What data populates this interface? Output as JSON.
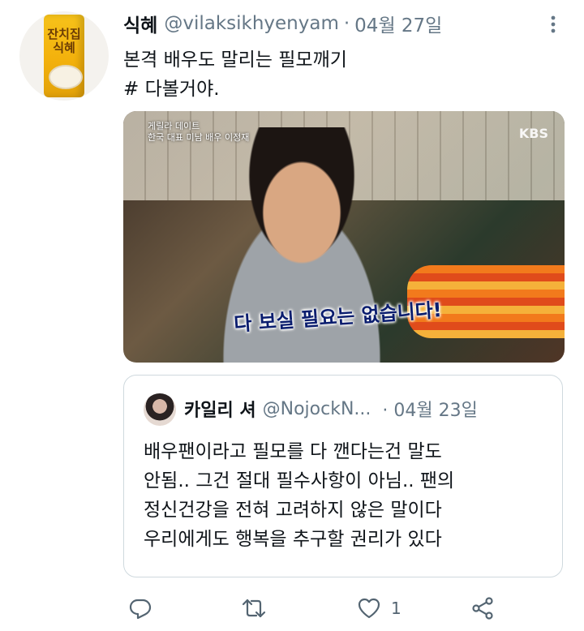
{
  "tweet": {
    "display_name": "식혜",
    "handle": "@vilaksikhyenyam",
    "separator": "·",
    "date": "04월 27일",
    "text_lines": [
      "본격 배우도 말리는 필모깨기",
      "# 다볼거야."
    ],
    "avatar_label": "잔치집 식혜"
  },
  "media": {
    "caption_top_left": [
      "게릴라 데이트",
      "한국 대표 미남 배우 이정재"
    ],
    "channel": "KBS",
    "subtitle": "다 보실 필요는 없습니다!"
  },
  "quoted": {
    "display_name": "카일리 셔",
    "handle": "@NojockN...",
    "separator": "·",
    "date": "04월 23일",
    "text_lines": [
      "배우팬이라고 필모를 다 깬다는건 말도",
      "안됨.. 그건 절대 필수사항이 아님.. 팬의",
      "정신건강을 전혀 고려하지 않은 말이다",
      "우리에게도 행복을 추구할 권리가 있다"
    ]
  },
  "actions": {
    "reply_icon": "reply-icon",
    "retweet_icon": "retweet-icon",
    "like_icon": "heart-icon",
    "like_count": "1",
    "share_icon": "share-icon"
  },
  "colors": {
    "text": "#0f1419",
    "secondary": "#657786",
    "icon": "#536471",
    "border": "#cfd9de"
  }
}
